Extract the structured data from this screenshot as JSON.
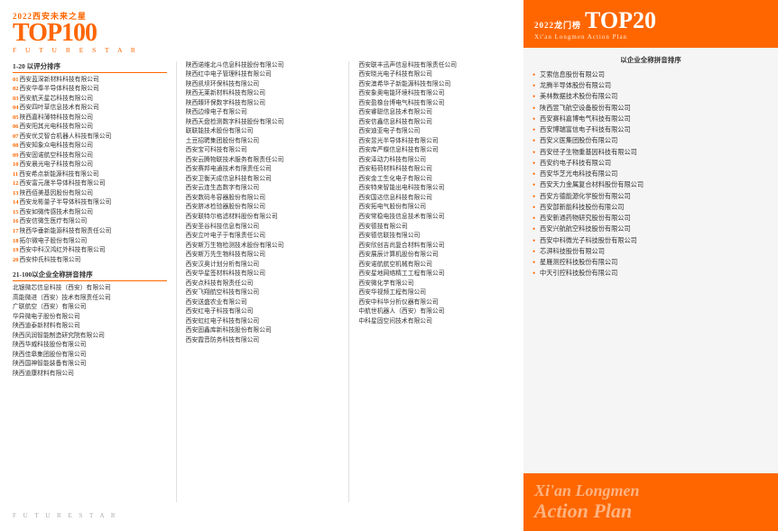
{
  "left": {
    "year_star": "2022西安未来之星",
    "top100": "TOP100",
    "sub_label": "F U T U R E   S T A R",
    "bottom_label": "F U T U R E   S T A R",
    "col1": {
      "section": "1-20 以评分排序",
      "items": [
        {
          "num": "01",
          "text": "西安蓝深新材料科技有限公司"
        },
        {
          "num": "02",
          "text": "西安华奉半导体科技有限公司"
        },
        {
          "num": "03",
          "text": "西安航天星芯科技有限公司"
        },
        {
          "num": "04",
          "text": "西安四叶草信息技术有限公司"
        },
        {
          "num": "05",
          "text": "陕西嘉科薄特科技有限公司"
        },
        {
          "num": "06",
          "text": "西安阳其光电科技有限公司"
        },
        {
          "num": "07",
          "text": "西安优艾智合机器人科技有限公司"
        },
        {
          "num": "08",
          "text": "西安知象众电科技有限公司"
        },
        {
          "num": "09",
          "text": "西安固诺航空科技有限公司"
        },
        {
          "num": "10",
          "text": "西安晨光电子科技有限公司"
        },
        {
          "num": "11",
          "text": "西安希点新能源科技有限公司"
        },
        {
          "num": "12",
          "text": "西安富元晟半导体科技有限公司"
        },
        {
          "num": "13",
          "text": "陕西佰美基因股份有限公司"
        },
        {
          "num": "14",
          "text": "西安龙彬量子半导体科技有限公司"
        },
        {
          "num": "15",
          "text": "西安如微传感技术有限公司"
        },
        {
          "num": "16",
          "text": "西安信微生医疗有限公司"
        },
        {
          "num": "17",
          "text": "陕西华垂新能源科技有限责任公司"
        },
        {
          "num": "18",
          "text": "拓尔微电子股份有限公司"
        },
        {
          "num": "19",
          "text": "西安中科汉鸿红外科技有限公司"
        },
        {
          "num": "20",
          "text": "西安仲氏科技有限公司"
        }
      ],
      "section2": "21-100以企业全称拼音排序",
      "items2": [
        "北银微芯信息科技（西安）有限公司",
        "高能微进（西安）技术有限责任公司",
        "广联航空（西安）有限公司",
        "华异微电子股份有限公司",
        "陕西迪泰新材料有限公司",
        "陕西凤润智能制造研究院有限公司",
        "陕西华威科技股份有限公司",
        "陕西佳皋集团股份有限公司",
        "陕西国神智能装备有限公司",
        "陕西道康材料有限公司"
      ]
    },
    "col2": {
      "items": [
        "陕西诺维北斗信息科技股份有限公司",
        "陕西红中电子管理科技有限公司",
        "陕西凯坝环保科技有限公司",
        "陕西无莱新材料科技有限公司",
        "陕西臻环保数字科技有限公司",
        "陕西边缘电子有限公司",
        "陕西天盘检测数字科技股份有限公司",
        "联联能技术股份有限公司",
        "土豆招聘集团股份有限公司",
        "西安宝可科技有限公司",
        "西安云腾物联技术服务有限责任公司",
        "西安赛邦电通技术有限责任公司",
        "西安卫衡天成信息科技有限公司",
        "西安云连生态数字有限公司",
        "西安数码冬容器股份有限公司",
        "西安脐冰检验器股份有限公司",
        "西安联特尔格滤材料股份有限公司",
        "西安圣谷科技信息有限公司",
        "西安立叶电子于有限责任公司",
        "西安斯万生物检测技术股份有限公司",
        "西安斯万先生物科技有限公司",
        "西安汉奥计划分析有限公司",
        "西安华星签材料科技有限公司",
        "西安点科技有限责任公司",
        "西安飞翔航空科技有限公司",
        "西安送盛农业有限公司",
        "西安红电子科技有限公司",
        "西安虹红电子科技有限公司",
        "西安固鑫库新科技股份有限公司",
        "西安霞音防务科技有限公司"
      ]
    },
    "col3": {
      "items": [
        "西安联丰迅声信息科技有限责任公司",
        "西安晓光电子科技有限公司",
        "西安澳希华子新能源科技有限公司",
        "西安象奥电能环境科技有限公司",
        "西安盈橡台博电气科技有限公司",
        "西安睿聪信息技术有限公司",
        "西安信鑫信息科技有限公司",
        "西安迪亚电子有限公司",
        "西安昱光半导体科技有限公司",
        "西安库严蝶信息科技有限公司",
        "西安泽动力科技有限公司",
        "西安稻荷材料科技有限公司",
        "西安金工生化电子有限公司",
        "西安特来智能出电科技有限公司",
        "西安国达信息科技有限公司",
        "西安拓电气股份有限公司",
        "西安常稳电技信息技术有限公司",
        "西安德技有限公司",
        "西安德信联技有限公司",
        "西安欣创吉尚复合材料有限公司",
        "西安展辰计算机股份有限公司",
        "西安诺航航空机械有限公司",
        "西安星地网络精工工程有限公司",
        "西安微化学有限公司",
        "西安华视频工程有限公司",
        "西安中科华分析仪器有限公司",
        "中航世机器人（西安）有限公司",
        "中科星固空间技术有限公司"
      ]
    }
  },
  "right": {
    "year": "2022龙门榜",
    "top20": "TOP20",
    "longmen": "龙门榜",
    "sub": "Xi'an Longmen Action Plan",
    "section_title": "以企业全称拼音排序",
    "items": [
      "艾索信息股份有限公司",
      "龙腾半导体股份有限公司",
      "美林数据技术股份有限公司",
      "陕西昱飞航空设备股份有限公司",
      "西安赛科嘉博电气科技有限公司",
      "西安博瑞富信电子科技有限公司",
      "西安义医集团股份有限公司",
      "西安径子生物重基因科技有限公司",
      "西安约电子科技有限公司",
      "西安华芝光电科技有限公司",
      "西安天力金属复合材料股份有限公司",
      "西安方德能源化学股份有限公司",
      "西安部新能科技股份有限公司",
      "西安新通药物研究股份有限公司",
      "西安兴航航空科技股份有限公司",
      "西安中科微光子科技股份有限公司",
      "芯湃科技股份有限公司",
      "星雁测控科技股份有限公司",
      "中天引控科技股份有限公司"
    ],
    "footer_line1": "Xi'an Longmen",
    "footer_line2": "Action Plan"
  }
}
